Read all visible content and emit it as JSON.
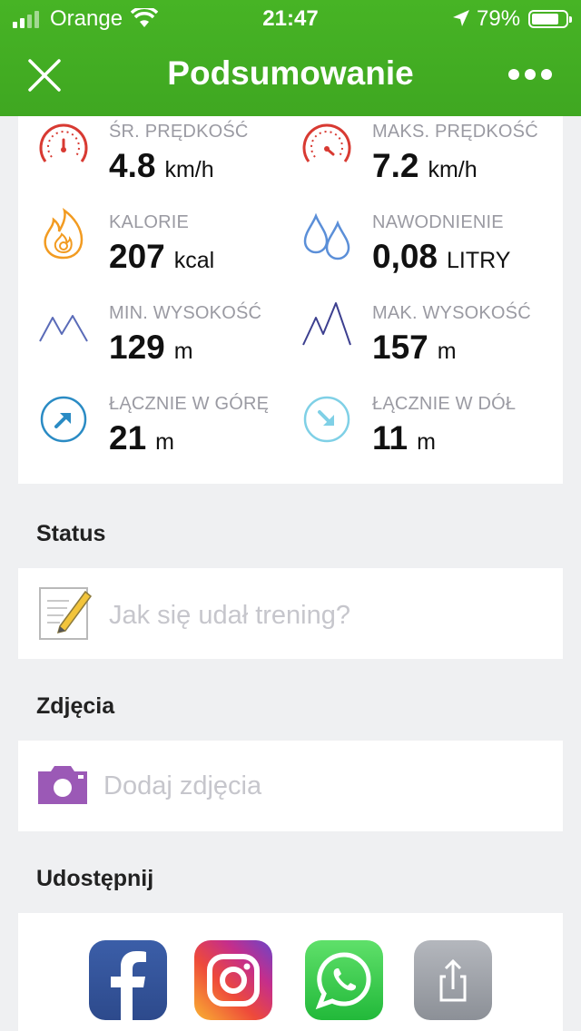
{
  "status_bar": {
    "carrier": "Orange",
    "time": "21:47",
    "battery": "79%"
  },
  "nav": {
    "title": "Podsumowanie"
  },
  "stats": [
    {
      "label": "ŚR. PRĘDKOŚĆ",
      "value": "4.8",
      "unit": "km/h",
      "icon": "speedometer-avg-icon"
    },
    {
      "label": "MAKS. PRĘDKOŚĆ",
      "value": "7.2",
      "unit": "km/h",
      "icon": "speedometer-max-icon"
    },
    {
      "label": "KALORIE",
      "value": "207",
      "unit": "kcal",
      "icon": "flame-icon"
    },
    {
      "label": "NAWODNIENIE",
      "value": "0,08",
      "unit": "LITRY",
      "icon": "water-drops-icon"
    },
    {
      "label": "MIN. WYSOKOŚĆ",
      "value": "129",
      "unit": "m",
      "icon": "mountain-min-icon"
    },
    {
      "label": "MAK. WYSOKOŚĆ",
      "value": "157",
      "unit": "m",
      "icon": "mountain-max-icon"
    },
    {
      "label": "ŁĄCZNIE W GÓRĘ",
      "value": "21",
      "unit": "m",
      "icon": "arrow-up-circle-icon"
    },
    {
      "label": "ŁĄCZNIE W DÓŁ",
      "value": "11",
      "unit": "m",
      "icon": "arrow-down-circle-icon"
    }
  ],
  "status_section": {
    "title": "Status",
    "placeholder": "Jak się udał trening?"
  },
  "photos_section": {
    "title": "Zdjęcia",
    "placeholder": "Dodaj zdjęcia"
  },
  "share_section": {
    "title": "Udostępnij",
    "buttons": [
      "facebook-icon",
      "instagram-icon",
      "whatsapp-icon",
      "share-icon"
    ]
  },
  "colors": {
    "header_green": "#47b425",
    "speed_red": "#d83a32",
    "flame_orange": "#f29b21",
    "water_blue": "#5b8fd8",
    "mountain_blue": "#5a6bb8",
    "up_blue": "#2a8bc4",
    "down_lightblue": "#7fd0e6",
    "camera_purple": "#9b59b6"
  }
}
